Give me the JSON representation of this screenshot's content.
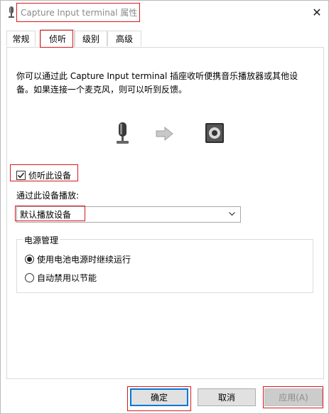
{
  "window": {
    "title": "Capture Input terminal 属性",
    "close_glyph": "✕"
  },
  "tabs": [
    {
      "label": "常规"
    },
    {
      "label": "侦听"
    },
    {
      "label": "级别"
    },
    {
      "label": "高级"
    }
  ],
  "listen": {
    "description": "你可以通过此 Capture Input terminal 插座收听便携音乐播放器或其他设备。如果连接一个麦克风，则可以听到反馈。",
    "listen_checkbox_label": "侦听此设备",
    "listen_checked": true,
    "playback_label": "通过此设备播放:",
    "playback_device_selected": "默认播放设备",
    "illustration_icons": [
      "microphone-icon",
      "arrow-right-icon",
      "speaker-icon"
    ]
  },
  "power": {
    "legend": "电源管理",
    "options": [
      {
        "label": "使用电池电源时继续运行",
        "selected": true
      },
      {
        "label": "自动禁用以节能",
        "selected": false
      }
    ]
  },
  "buttons": {
    "ok": "确定",
    "cancel": "取消",
    "apply": "应用(A)"
  },
  "colors": {
    "highlight_box": "#d9181c",
    "focus_border": "#0078d7"
  }
}
